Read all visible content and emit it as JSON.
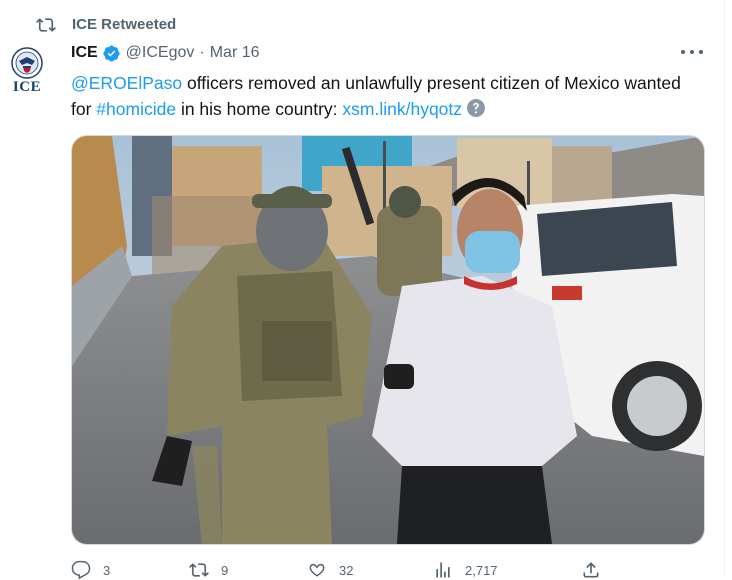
{
  "retweet": {
    "label": "ICE Retweeted"
  },
  "avatar": {
    "text": "ICE"
  },
  "tweet": {
    "author_name": "ICE",
    "handle": "@ICEgov",
    "separator": "·",
    "date": "Mar 16",
    "text": {
      "mention": "@EROElPaso",
      "part1": " officers removed an unlawfully present citizen of Mexico wanted for ",
      "hashtag": "#homicide",
      "part2": " in his home country: ",
      "link": "xsm.link/hyqotz"
    }
  },
  "actions": {
    "reply_count": "3",
    "retweet_count": "9",
    "like_count": "32",
    "views_count": "2,717"
  },
  "colors": {
    "link": "#1d9bf0",
    "verified": "#1d9bf0",
    "muted": "#536471"
  },
  "icons": [
    "retweet-icon",
    "verified-badge-icon",
    "more-icon",
    "help-icon",
    "reply-icon",
    "like-icon",
    "views-icon",
    "share-icon"
  ]
}
